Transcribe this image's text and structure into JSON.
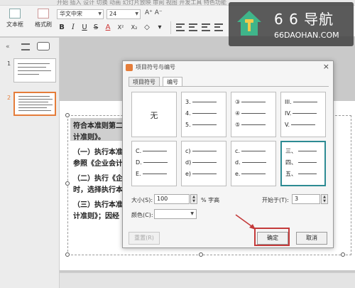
{
  "ribbon": {
    "top_title": "开始 插入 设计 切换 动画 幻灯片放映 审阅 视图 开发工具 特色功能",
    "textbox_label": "文本框",
    "format_brush_label": "格式刷",
    "font_name": "华文中宋",
    "font_size": "24",
    "bold": "B",
    "italic": "I",
    "underline": "U",
    "strike": "S",
    "font_color": "A",
    "superscript": "X²",
    "subscript": "X₂"
  },
  "thumbnails": [
    {
      "number": "1"
    },
    {
      "number": "2"
    }
  ],
  "document": {
    "line1": "符合本准则第二",
    "line2": "计准则》。",
    "line3": "（一）执行本准",
    "line4": "参照《企业会计",
    "line5": "（二）执行《企",
    "line6": "时，选择执行本",
    "line7": "（三）执行本准",
    "line8": "计准则》；因经"
  },
  "dialog": {
    "title": "项目符号与编号",
    "close": "×",
    "tabs": [
      "项目符号",
      "编号"
    ],
    "active_tab": "编号",
    "styles": [
      {
        "type": "none",
        "label": "无"
      },
      {
        "type": "list",
        "items": [
          "3.",
          "4.",
          "5."
        ]
      },
      {
        "type": "list",
        "items": [
          "③",
          "④",
          "⑤"
        ]
      },
      {
        "type": "list",
        "items": [
          "III.",
          "IV.",
          "V."
        ]
      },
      {
        "type": "list",
        "items": [
          "C.",
          "D.",
          "E."
        ]
      },
      {
        "type": "list",
        "items": [
          "c)",
          "d)",
          "e)"
        ]
      },
      {
        "type": "list",
        "items": [
          "c.",
          "d.",
          "e."
        ]
      },
      {
        "type": "list",
        "items": [
          "三、",
          "四、",
          "五、"
        ],
        "selected": true
      }
    ],
    "size_label": "大小(S):",
    "size_value": "100",
    "size_unit": "% 字高",
    "start_label": "开始于(T):",
    "start_value": "3",
    "color_label": "颜色(C):",
    "reset_label": "重置(R)",
    "ok_label": "确定",
    "cancel_label": "取消"
  },
  "watermark": {
    "title": "6 6 导航",
    "domain": "66DAOHAN.COM",
    "icon": "house-icon"
  },
  "colors": {
    "accent": "#e57d3a",
    "selected_border": "#2d8b93",
    "highlight_red": "#c43a3a"
  }
}
